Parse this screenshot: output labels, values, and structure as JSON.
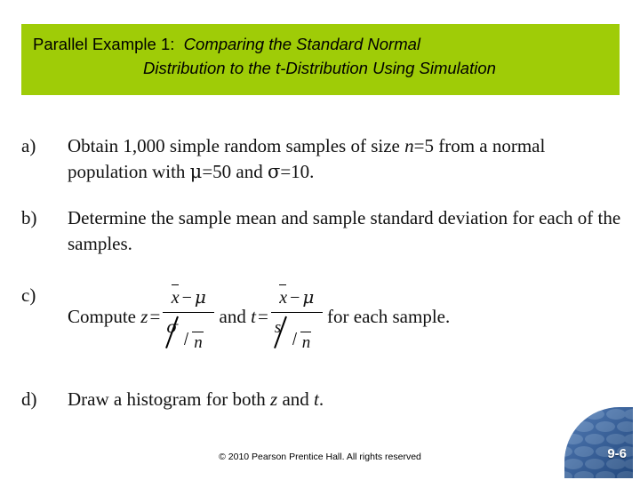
{
  "slide": {
    "background_color": "#ffffff",
    "title": {
      "banner_color": "#9fcc07",
      "line1_plain": "Parallel Example 1:",
      "line1_italic": "Comparing the Standard Normal",
      "line2_italic": "Distribution to the t-Distribution Using Simulation"
    },
    "items": [
      {
        "marker": "a)",
        "text_part1": "Obtain 1,000 simple random samples of size ",
        "var_n": "n",
        "text_part2": "=5 from a normal population with ",
        "sym_mu": "μ",
        "text_part3": "=50 and ",
        "sym_sigma": "σ",
        "text_part4": "=10."
      },
      {
        "marker": "b)",
        "text": "Determine the sample mean and sample standard deviation for each of the samples."
      },
      {
        "marker": "c)",
        "lead": "Compute",
        "formula_z": {
          "lhs": "z",
          "eq": "=",
          "numerator_var": "x",
          "numerator_minus": "−",
          "numerator_mu": "μ",
          "denominator_top": "σ",
          "denominator_root_var": "n"
        },
        "conjunction": "and",
        "formula_t": {
          "lhs": "t",
          "eq": "=",
          "numerator_var": "x",
          "numerator_minus": "−",
          "numerator_mu": "μ",
          "denominator_top": "s",
          "denominator_root_var": "n"
        },
        "tail": "for each sample."
      },
      {
        "marker": "d)",
        "text_part1": "Draw a histogram for both ",
        "var_z": "z",
        "text_part2": " and ",
        "var_t": "t",
        "text_part3": "."
      }
    ],
    "footer": {
      "copyright": "© 2010 Pearson Prentice Hall. All rights reserved"
    },
    "page_badge": {
      "number": "9-6",
      "color": "#2d5fa6",
      "text_color": "#ffffff"
    }
  }
}
